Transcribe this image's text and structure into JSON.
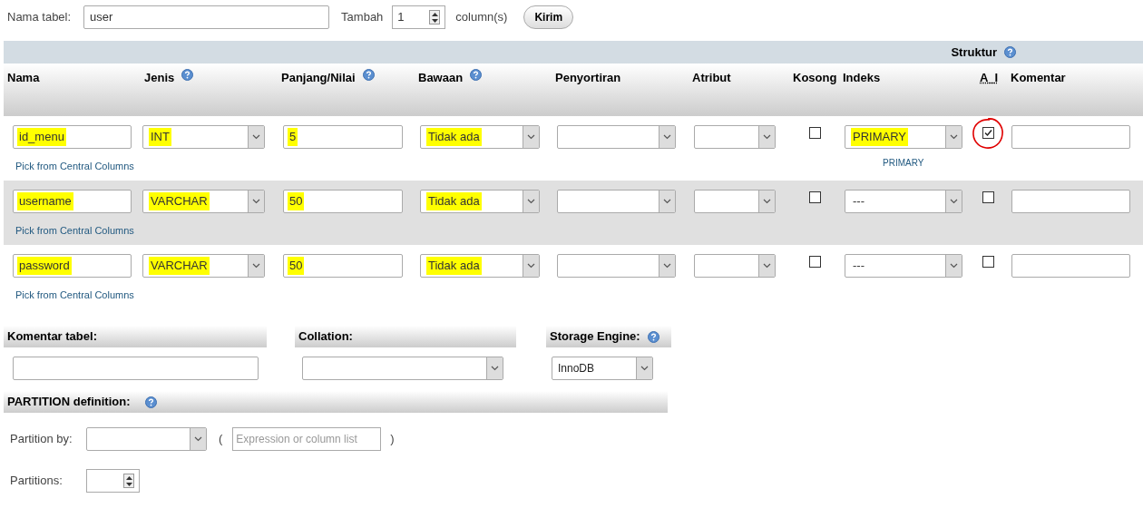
{
  "top": {
    "table_name_label": "Nama tabel:",
    "table_name": "user",
    "add_label": "Tambah",
    "add_count": "1",
    "columns_label": "column(s)",
    "submit": "Kirim"
  },
  "structure": {
    "title": "Struktur",
    "help": true,
    "columns": [
      {
        "label": "Nama",
        "help": false,
        "abbr": false
      },
      {
        "label": "Jenis",
        "help": true,
        "abbr": false
      },
      {
        "label": "Panjang/Nilai",
        "help": true,
        "abbr": false
      },
      {
        "label": "Bawaan",
        "help": true,
        "abbr": false
      },
      {
        "label": "Penyortiran",
        "help": false,
        "abbr": false
      },
      {
        "label": "Atribut",
        "help": false,
        "abbr": false
      },
      {
        "label": "Kosong",
        "help": false,
        "abbr": false
      },
      {
        "label": "Indeks",
        "help": false,
        "abbr": false
      },
      {
        "label": "A_I",
        "help": false,
        "abbr": true
      },
      {
        "label": "Komentar",
        "help": false,
        "abbr": false
      }
    ]
  },
  "rows": [
    {
      "name": {
        "value": "id_menu",
        "highlighted": true
      },
      "type": {
        "value": "INT",
        "highlighted": true
      },
      "length": {
        "value": "5",
        "highlighted": true
      },
      "default": {
        "value": "Tidak ada",
        "highlighted": true
      },
      "null": false,
      "index": {
        "value": "PRIMARY",
        "highlighted": true
      },
      "index_note": "PRIMARY",
      "ai": true,
      "circled": true,
      "pick_link": "Pick from Central Columns"
    },
    {
      "name": {
        "value": "username",
        "highlighted": true
      },
      "type": {
        "value": "VARCHAR",
        "highlighted": true
      },
      "length": {
        "value": "50",
        "highlighted": true
      },
      "default": {
        "value": "Tidak ada",
        "highlighted": true
      },
      "null": false,
      "index": {
        "value": "---",
        "highlighted": false
      },
      "ai": false,
      "circled": false,
      "pick_link": "Pick from Central Columns"
    },
    {
      "name": {
        "value": "password",
        "highlighted": true
      },
      "type": {
        "value": "VARCHAR",
        "highlighted": true
      },
      "length": {
        "value": "50",
        "highlighted": true
      },
      "default": {
        "value": "Tidak ada",
        "highlighted": true
      },
      "null": false,
      "index": {
        "value": "---",
        "highlighted": false
      },
      "ai": false,
      "circled": false,
      "pick_link": "Pick from Central Columns"
    }
  ],
  "table_comment": {
    "label": "Komentar tabel:"
  },
  "collation": {
    "label": "Collation:"
  },
  "storage_engine": {
    "label": "Storage Engine:",
    "help": true,
    "value": "InnoDB"
  },
  "partition": {
    "title": "PARTITION definition:",
    "help": true,
    "by_label": "Partition by:",
    "open_paren": "(",
    "expression_placeholder": "Expression or column list",
    "close_paren": ")",
    "partitions_label": "Partitions:"
  }
}
